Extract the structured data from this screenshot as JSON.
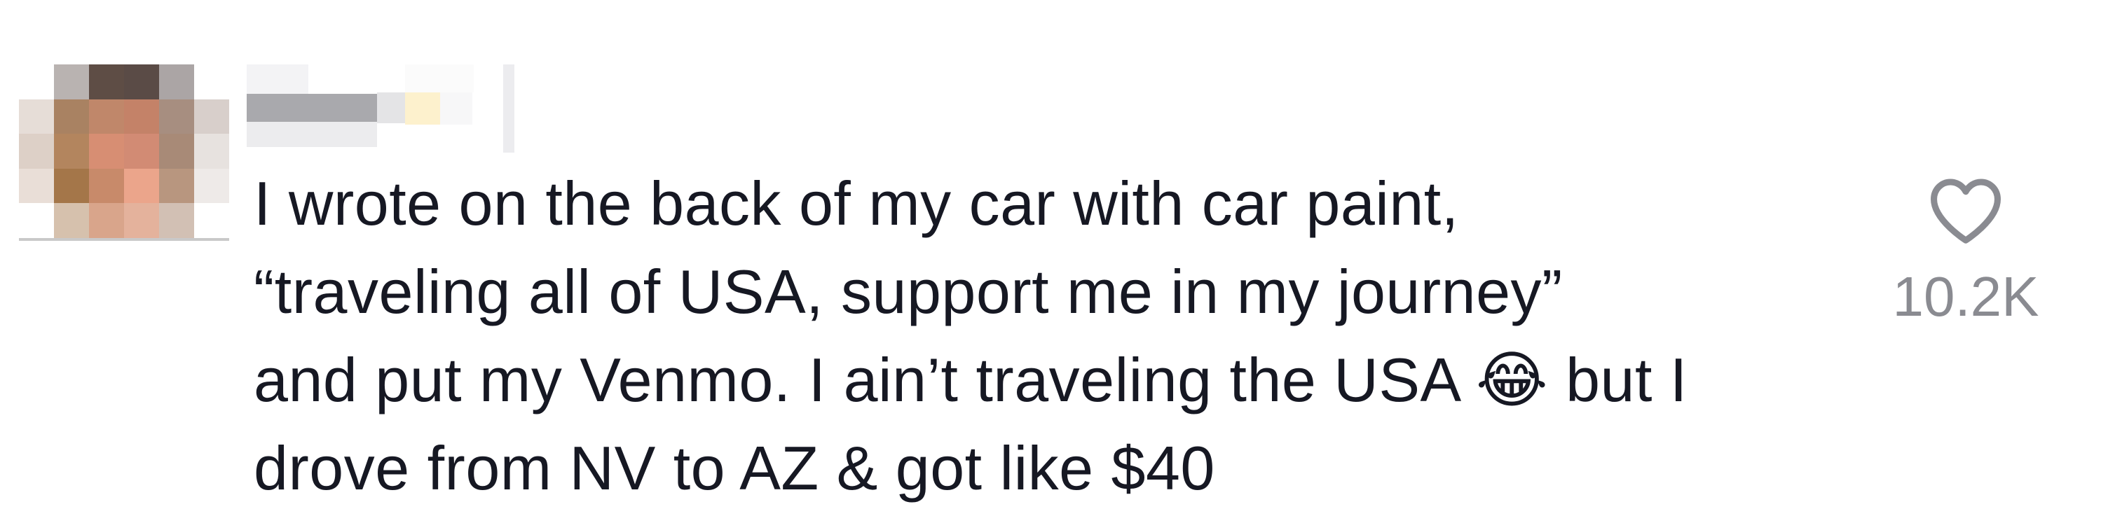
{
  "comment": {
    "text": "I wrote on the back of my car with car paint,\n“traveling all of USA, support me in my journey”\nand put my Venmo. I ain’t traveling the USA 😂 but I\ndrove from NV to AZ & got like $40",
    "like_count": "10.2K",
    "like_icon": "heart-outline-icon",
    "avatar": "blurred-profile-photo",
    "username": "blurred-username"
  },
  "colors": {
    "text": "#161823",
    "muted": "#8a8b91",
    "background": "#ffffff"
  }
}
